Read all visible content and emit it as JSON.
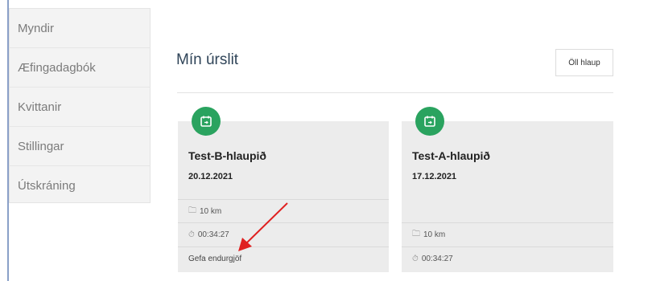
{
  "sidebar": {
    "items": [
      {
        "label": "Myndir"
      },
      {
        "label": "Æfingadagbók"
      },
      {
        "label": "Kvittanir"
      },
      {
        "label": "Stillingar"
      },
      {
        "label": "Útskráning"
      }
    ]
  },
  "main": {
    "title": "Mín úrslit",
    "all_races_label": "Öll hlaup"
  },
  "cards": [
    {
      "name": "Test-B-hlaupið",
      "date": "20.12.2021",
      "distance": "10 km",
      "time": "00:34:27",
      "feedback": "Gefa endurgjöf",
      "icon": "calendar-icon"
    },
    {
      "name": "Test-A-hlaupið",
      "date": "17.12.2021",
      "distance": "10 km",
      "time": "00:34:27",
      "icon": "calendar-icon"
    }
  ],
  "colors": {
    "accent_green": "#2aa35f",
    "annotation_red": "#e02020",
    "title_color": "#2f4458"
  }
}
